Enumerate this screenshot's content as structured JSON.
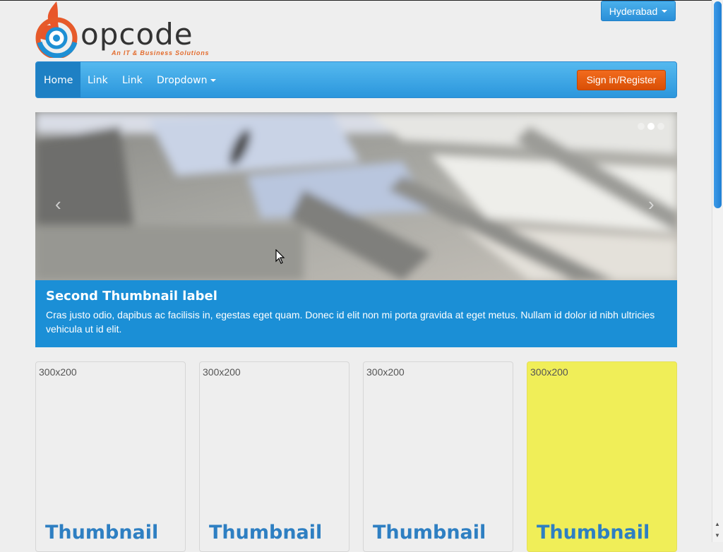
{
  "header": {
    "logo_text": "opcode",
    "logo_tagline": "An IT & Business Solutions",
    "city_dropdown": "Hyderabad"
  },
  "navbar": {
    "items": [
      {
        "label": "Home",
        "active": true
      },
      {
        "label": "Link"
      },
      {
        "label": "Link"
      },
      {
        "label": "Dropdown"
      }
    ],
    "signin_label": "Sign in/Register"
  },
  "carousel": {
    "caption_title": "Second Thumbnail label",
    "caption_text": "Cras justo odio, dapibus ac facilisis in, egestas eget quam. Donec id elit non mi porta gravida at eget metus. Nullam id dolor id nibh ultricies vehicula ut id elit.",
    "prev_glyph": "‹",
    "next_glyph": "›",
    "indicator_count": 3,
    "active_indicator": 2
  },
  "thumbnails": [
    {
      "size_label": "300x200",
      "title": "Thumbnail"
    },
    {
      "size_label": "300x200",
      "title": "Thumbnail"
    },
    {
      "size_label": "300x200",
      "title": "Thumbnail"
    },
    {
      "size_label": "300x200",
      "title": "Thumbnail",
      "highlighted": true
    }
  ],
  "colors": {
    "navbar_blue": "#2b96dc",
    "signin_orange": "#e45a0f",
    "caption_blue": "#1b8fd6",
    "thumbnail_title_blue": "#2e7fc2",
    "highlight_yellow": "#f0ee58",
    "logo_orange": "#e36b2c"
  }
}
